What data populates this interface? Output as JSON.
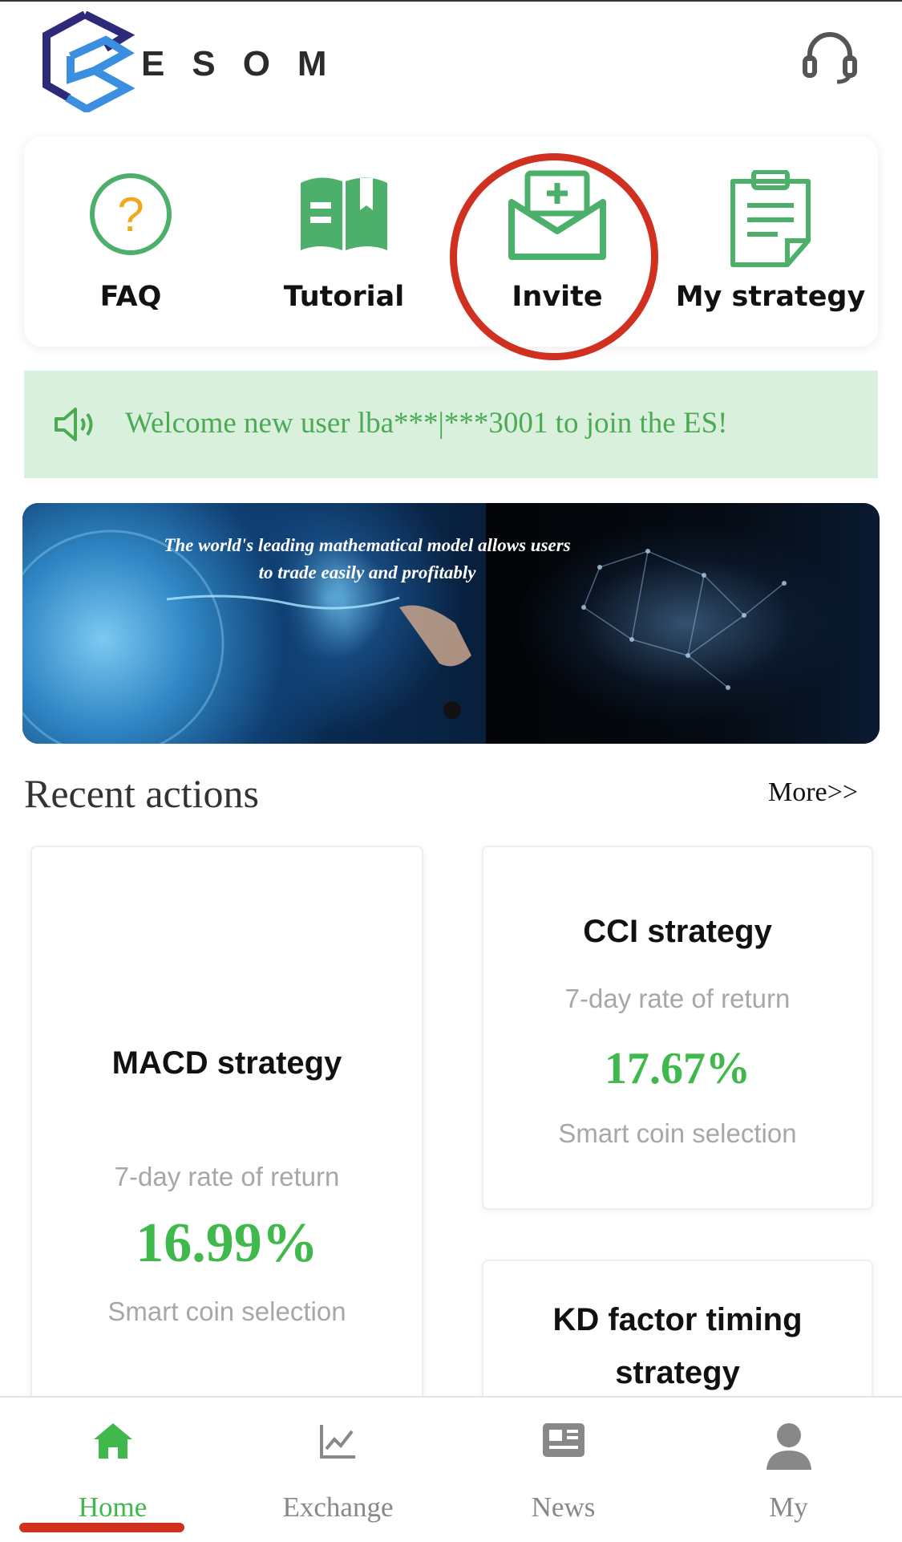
{
  "header": {
    "logo_text": "ESOM",
    "support_icon": "headset-icon",
    "colors": {
      "logo_dark": "#2e2a7a",
      "logo_light": "#3a8fe0"
    }
  },
  "shortcuts": [
    {
      "label": "FAQ",
      "icon": "question-circle-icon"
    },
    {
      "label": "Tutorial",
      "icon": "book-icon"
    },
    {
      "label": "Invite",
      "icon": "envelope-plus-icon",
      "annotated": true
    },
    {
      "label": "My strategy",
      "icon": "clipboard-icon"
    }
  ],
  "notice": {
    "icon": "speaker-icon",
    "text": "Welcome new user lba***|***3001 to join the ES!"
  },
  "banner": {
    "caption": "The world's leading mathematical model allows users to trade easily and profitably"
  },
  "recent": {
    "title": "Recent actions",
    "more_label": "More>>",
    "cards": [
      {
        "title": "MACD strategy",
        "rate_label": "7-day rate of return",
        "rate": "16.99%",
        "tag": "Smart coin selection"
      },
      {
        "title": "CCI strategy",
        "rate_label": "7-day rate of return",
        "rate": "17.67%",
        "tag": "Smart coin selection"
      },
      {
        "title_line1": "KD factor timing",
        "title_line2": "strategy"
      }
    ]
  },
  "nav": {
    "items": [
      {
        "label": "Home",
        "icon": "home-icon",
        "active": true
      },
      {
        "label": "Exchange",
        "icon": "chart-line-icon"
      },
      {
        "label": "News",
        "icon": "newspaper-icon"
      },
      {
        "label": "My",
        "icon": "user-icon"
      }
    ]
  },
  "colors": {
    "accent_green": "#3fb94c",
    "icon_green": "#4caf6a",
    "annotation_red": "#d0301f",
    "notice_bg": "#d8f0dc"
  }
}
